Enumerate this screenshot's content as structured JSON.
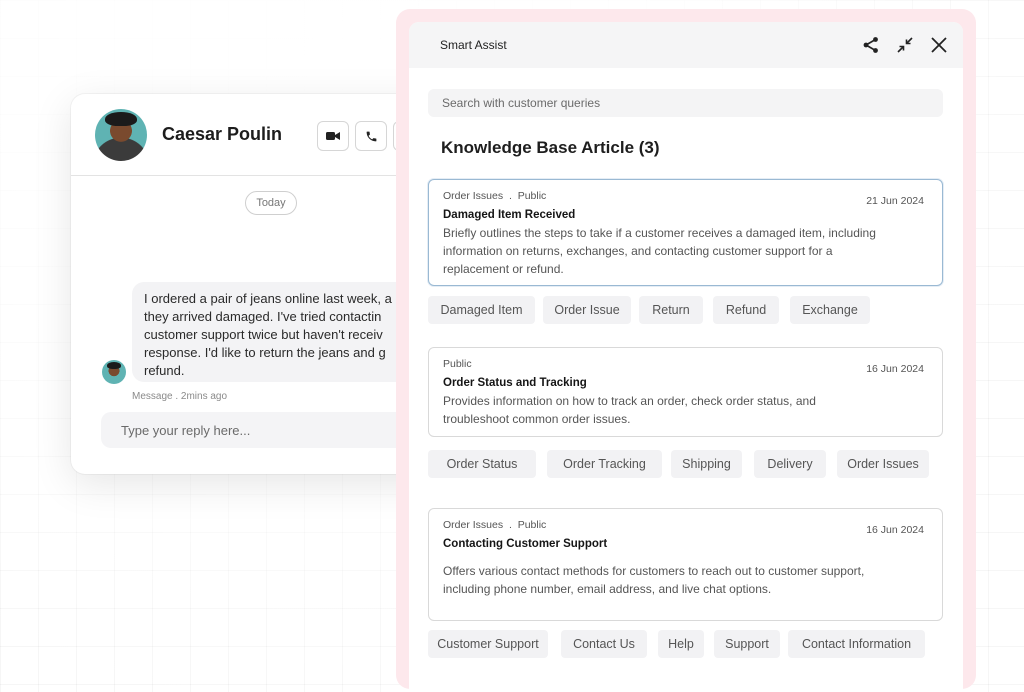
{
  "chat": {
    "contact_name": "Caesar Poulin",
    "day_label": "Today",
    "message_lines": [
      "I ordered a pair of jeans online last week, a",
      "they arrived damaged. I've tried contactin",
      "customer support twice but haven't receiv",
      "response. I'd like to return the jeans and g",
      "refund."
    ],
    "message_meta": "Message . 2mins ago",
    "reply_placeholder": "Type your reply here..."
  },
  "panel": {
    "title": "Smart Assist",
    "search_placeholder": "Search with customer queries",
    "kb_heading": "Knowledge Base Article (3)",
    "articles": [
      {
        "meta": "Order Issues  .  Public",
        "date": "21 Jun 2024",
        "title": "Damaged Item Received",
        "desc_lines": [
          "Briefly outlines the steps to take if a customer receives a damaged item, including",
          "information on returns, exchanges, and contacting customer support for a",
          "replacement or refund."
        ],
        "tags": [
          "Damaged Item",
          "Order Issue",
          "Return",
          "Refund",
          "Exchange"
        ]
      },
      {
        "meta": "Public",
        "date": "16 Jun 2024",
        "title": "Order Status and Tracking",
        "desc_lines": [
          "Provides information on how to track an order, check order status, and",
          "troubleshoot common order issues."
        ],
        "tags": [
          "Order Status",
          "Order Tracking",
          "Shipping",
          "Delivery",
          "Order Issues"
        ]
      },
      {
        "meta": "Order Issues  .  Public",
        "date": "16 Jun 2024",
        "title": "Contacting Customer Support",
        "desc_lines": [
          "Offers various contact methods for customers to reach out to customer support,",
          "including phone number, email address, and live chat options."
        ],
        "tags": [
          "Customer Support",
          "Contact Us",
          "Help",
          "Support",
          "Contact Information"
        ]
      }
    ]
  },
  "icons": {
    "video": "video-camera-icon",
    "phone": "phone-icon",
    "share": "share-icon",
    "collapse": "collapse-arrows-icon",
    "close": "close-icon"
  },
  "colors": {
    "panel_frame": "#fde8ec",
    "selected_border": "#9ab9d3",
    "avatar_bg": "#5fb3b3"
  }
}
